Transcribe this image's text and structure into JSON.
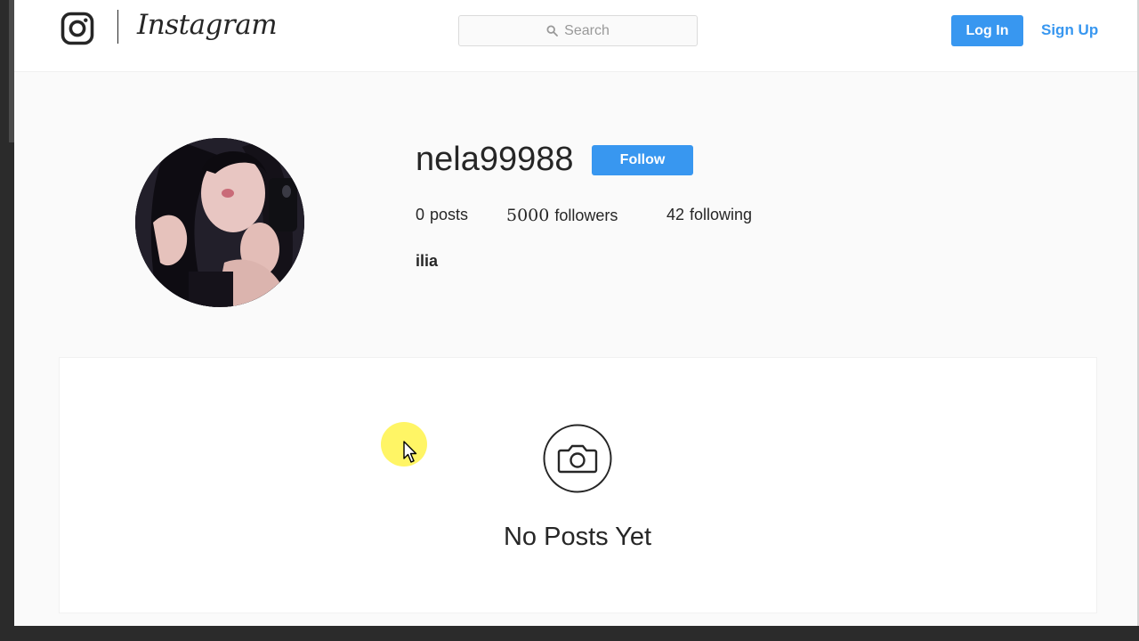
{
  "header": {
    "logo_icon": "instagram-glyph-icon",
    "wordmark": "Instagram",
    "search_placeholder": "Search",
    "search_icon": "search-icon",
    "login_label": "Log In",
    "signup_label": "Sign Up"
  },
  "profile": {
    "username": "nela99988",
    "follow_label": "Follow",
    "stats": {
      "posts_count": "0",
      "posts_label": "posts",
      "followers_count": "5000",
      "followers_label": "followers",
      "following_count": "42",
      "following_label": "following"
    },
    "bio": "ilia"
  },
  "posts": {
    "empty_icon": "camera-icon",
    "empty_text": "No Posts Yet"
  },
  "colors": {
    "accent": "#3897f0",
    "page_bg": "#fafafa",
    "text": "#262626",
    "cursor_highlight": "#fff34a"
  }
}
